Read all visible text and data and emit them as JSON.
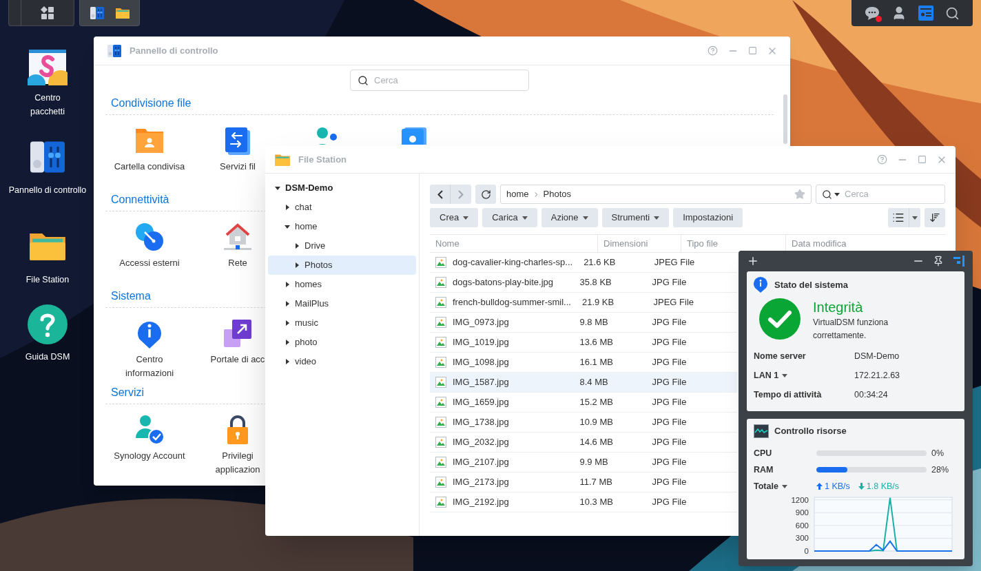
{
  "top_tray": {
    "chat_notification": true
  },
  "desktop_icons": [
    {
      "label": "Centro\npacchetti"
    },
    {
      "label": "Pannello di controllo"
    },
    {
      "label": "File Station"
    },
    {
      "label": "Guida DSM"
    }
  ],
  "control_panel": {
    "title": "Pannello di controllo",
    "search": {
      "placeholder": "Cerca"
    },
    "sections": [
      {
        "title": "Condivisione file",
        "items": [
          {
            "label": "Cartella condivisa"
          },
          {
            "label": "Servizi fil"
          },
          {
            "covered": true
          },
          {
            "covered": true
          }
        ]
      },
      {
        "title": "Connettività",
        "items": [
          {
            "label": "Accessi esterni"
          },
          {
            "label": "Rete"
          }
        ]
      },
      {
        "title": "Sistema",
        "items": [
          {
            "label": "Centro\ninformazioni"
          },
          {
            "label": "Portale di acc"
          }
        ]
      },
      {
        "title": "Servizi",
        "items": [
          {
            "label": "Synology Account"
          },
          {
            "label": "Privilegi\napplicazion"
          }
        ]
      }
    ]
  },
  "file_station": {
    "title": "File Station",
    "tree": [
      {
        "label": "DSM-Demo",
        "expanded": true,
        "selected": false,
        "children": [
          {
            "label": "chat",
            "expanded": false,
            "selected": false
          },
          {
            "label": "home",
            "expanded": true,
            "selected": false,
            "children": [
              {
                "label": "Drive",
                "expanded": false,
                "selected": false
              },
              {
                "label": "Photos",
                "expanded": false,
                "selected": true
              }
            ]
          },
          {
            "label": "homes",
            "expanded": false,
            "selected": false
          },
          {
            "label": "MailPlus",
            "expanded": false,
            "selected": false
          },
          {
            "label": "music",
            "expanded": false,
            "selected": false
          },
          {
            "label": "photo",
            "expanded": false,
            "selected": false
          },
          {
            "label": "video",
            "expanded": false,
            "selected": false
          }
        ]
      }
    ],
    "path": [
      "home",
      "Photos"
    ],
    "search": {
      "placeholder": "Cerca"
    },
    "actions": [
      {
        "label": "Crea",
        "dropdown": true
      },
      {
        "label": "Carica",
        "dropdown": true
      },
      {
        "label": "Azione",
        "dropdown": true
      },
      {
        "label": "Strumenti",
        "dropdown": true
      },
      {
        "label": "Impostazioni",
        "dropdown": false
      }
    ],
    "columns": [
      "Nome",
      "Dimensioni",
      "Tipo file",
      "Data modifica"
    ],
    "rows": [
      {
        "name": "dog-cavalier-king-charles-sp...",
        "size": "21.6 KB",
        "type": "JPEG File",
        "selected": false
      },
      {
        "name": "dogs-batons-play-bite.jpg",
        "size": "35.8 KB",
        "type": "JPG File",
        "selected": false
      },
      {
        "name": "french-bulldog-summer-smil...",
        "size": "21.9 KB",
        "type": "JPEG File",
        "selected": false
      },
      {
        "name": "IMG_0973.jpg",
        "size": "9.8 MB",
        "type": "JPG File",
        "selected": false
      },
      {
        "name": "IMG_1019.jpg",
        "size": "13.6 MB",
        "type": "JPG File",
        "selected": false
      },
      {
        "name": "IMG_1098.jpg",
        "size": "16.1 MB",
        "type": "JPG File",
        "selected": false
      },
      {
        "name": "IMG_1587.jpg",
        "size": "8.4 MB",
        "type": "JPG File",
        "selected": true
      },
      {
        "name": "IMG_1659.jpg",
        "size": "15.2 MB",
        "type": "JPG File",
        "selected": false
      },
      {
        "name": "IMG_1738.jpg",
        "size": "10.9 MB",
        "type": "JPG File",
        "selected": false
      },
      {
        "name": "IMG_2032.jpg",
        "size": "14.6 MB",
        "type": "JPG File",
        "selected": false
      },
      {
        "name": "IMG_2107.jpg",
        "size": "9.9 MB",
        "type": "JPG File",
        "selected": false
      },
      {
        "name": "IMG_2173.jpg",
        "size": "11.7 MB",
        "type": "JPG File",
        "selected": false
      },
      {
        "name": "IMG_2192.jpg",
        "size": "10.3 MB",
        "type": "JPG File",
        "selected": false
      }
    ]
  },
  "widget": {
    "status": {
      "title": "Stato del sistema",
      "state": "Integrità",
      "message": "VirtualDSM funziona correttamente.",
      "rows": [
        {
          "label": "Nome server",
          "value": "DSM-Demo",
          "dropdown": false
        },
        {
          "label": "LAN 1",
          "value": "172.21.2.63",
          "dropdown": true
        },
        {
          "label": "Tempo di attività",
          "value": "00:34:24",
          "dropdown": false
        }
      ]
    },
    "resources": {
      "title": "Controllo risorse",
      "meters": [
        {
          "label": "CPU",
          "level": 0,
          "reading": "0%"
        },
        {
          "label": "RAM",
          "level": 0.28,
          "reading": "28%"
        }
      ],
      "network": {
        "label": "Totale",
        "upload": "1 KB/s",
        "download": "1.8 KB/s"
      },
      "chart_data": {
        "type": "line",
        "grid": true,
        "ylim": [
          0,
          1260
        ],
        "yticks": [
          0,
          300,
          600,
          900,
          1200
        ],
        "series": [
          {
            "color": "#1a73e8",
            "values": [
              0,
              0,
              0,
              0,
              0,
              0,
              0,
              0,
              0,
              150,
              20,
              230,
              0,
              0,
              0,
              0,
              0,
              0,
              0,
              0,
              0
            ]
          },
          {
            "color": "#19b0a8",
            "values": [
              null,
              null,
              null,
              null,
              null,
              null,
              null,
              null,
              0,
              20,
              10,
              1250,
              0,
              null,
              null,
              null,
              null,
              null,
              null,
              null,
              null
            ]
          }
        ]
      }
    }
  }
}
